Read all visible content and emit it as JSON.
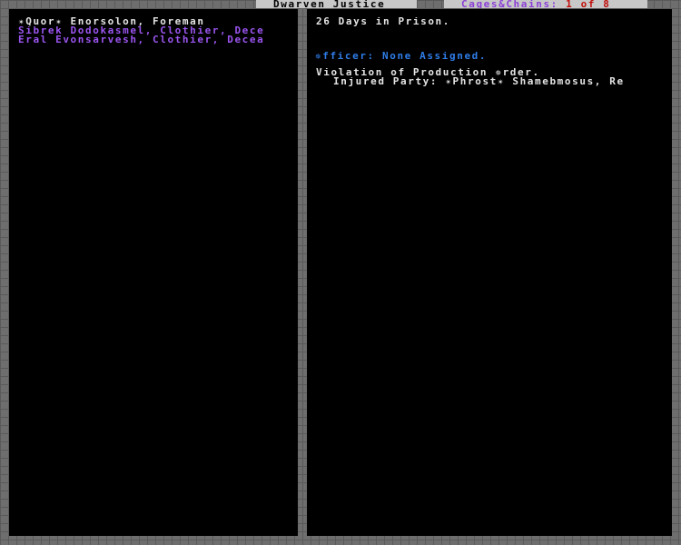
{
  "header": {
    "title": "Dwarven Justice",
    "cages_label": "Cages&Chains:",
    "page_indicator": "1 of 8"
  },
  "left_list": [
    {
      "text": "✴Quor✴ Enorsolon, Foreman",
      "color": "#e4e4e4"
    },
    {
      "text": "Sibrek Dodokasmel, Clothier, Dece",
      "color": "#9b55f0"
    },
    {
      "text": "Eral Evonsarvesh, Clothier, Decea",
      "color": "#9b55f0"
    }
  ],
  "detail": {
    "days_in_prison": "26 Days in Prison.",
    "officer": "✵fficer: None Assigned.",
    "violation": "Violation of Production ✵rder.",
    "injured_party": "Injured Party: ✴Phrost✴ Shamebmosus, Re"
  },
  "colors": {
    "panel_background": "#000000",
    "border": "#6e6e6e",
    "text_white": "#e4e4e4",
    "text_purple": "#9b55f0",
    "text_blue": "#2f7de8",
    "text_red": "#c0100c"
  }
}
